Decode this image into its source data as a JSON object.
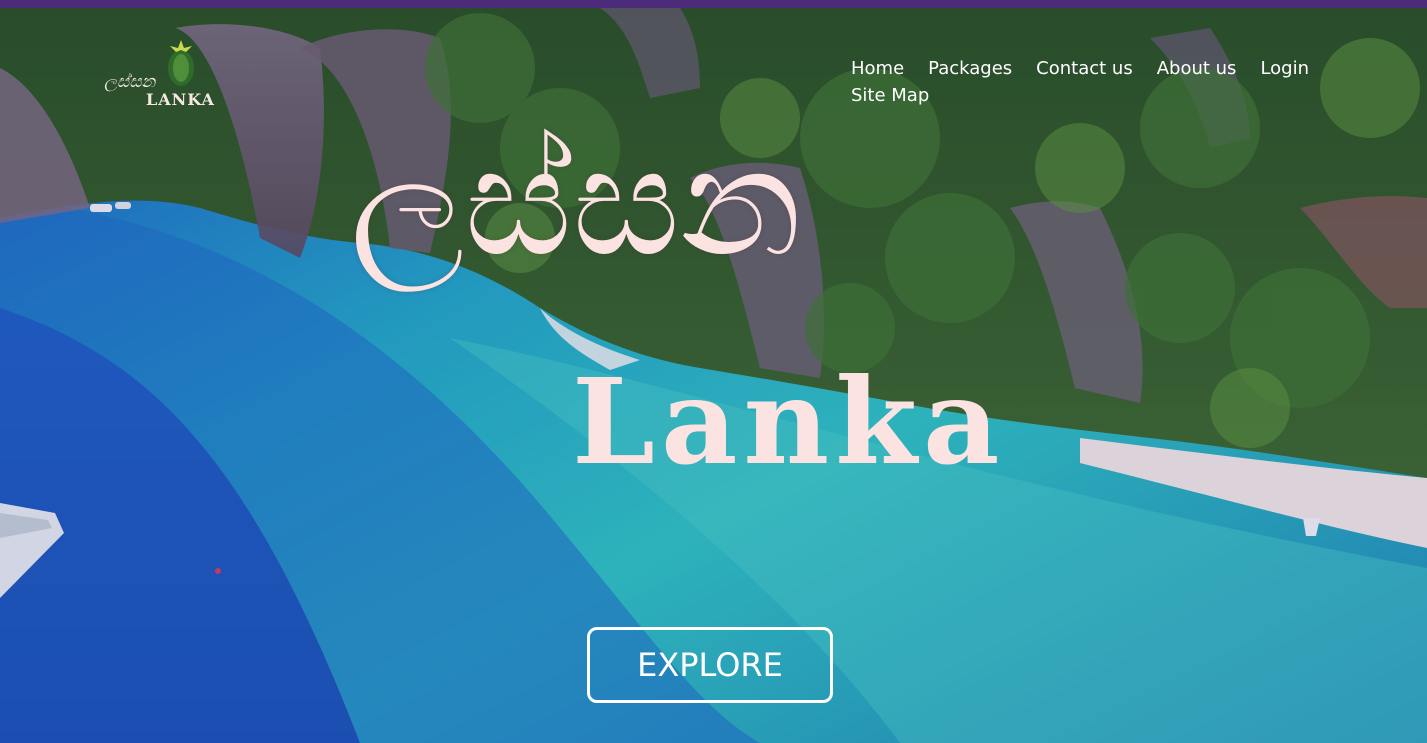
{
  "brand": {
    "logo_script": "ලස්සන",
    "logo_word": "LANKA"
  },
  "nav": {
    "items": [
      {
        "label": "Home"
      },
      {
        "label": "Packages"
      },
      {
        "label": "Contact us"
      },
      {
        "label": "About us"
      },
      {
        "label": "Login"
      },
      {
        "label": "Site Map"
      }
    ]
  },
  "hero": {
    "title_script": "ලස්සන",
    "title_word": "Lanka",
    "cta_label": "EXPLORE"
  },
  "colors": {
    "topbar": "#4b2b7a",
    "title": "#fbe3e1",
    "nav_text": "#ffffff",
    "button_border": "#ffffff"
  }
}
